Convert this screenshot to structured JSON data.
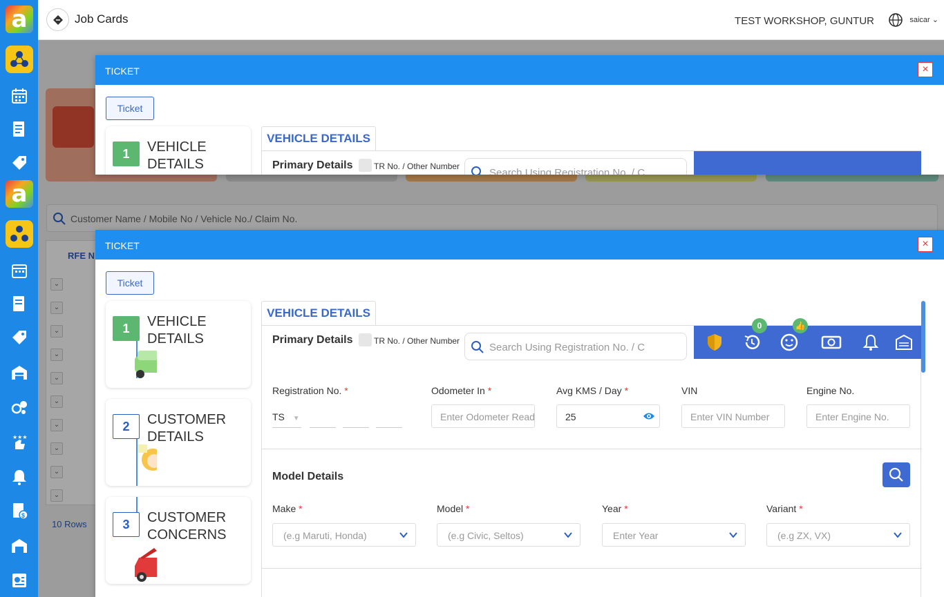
{
  "topbar": {
    "title": "Job Cards",
    "workshop": "TEST WORKSHOP, GUNTUR",
    "username": "saicar"
  },
  "background": {
    "search_placeholder": "Customer Name / Mobile No / Vehicle No./ Claim No.",
    "table_header": "RFE N",
    "rows_label": "10 Rows"
  },
  "modal": {
    "title": "TICKET",
    "close": "×",
    "ticket_button": "Ticket",
    "steps": [
      {
        "num": "1",
        "label_line1": "VEHICLE",
        "label_line2": "DETAILS"
      },
      {
        "num": "2",
        "label_line1": "CUSTOMER",
        "label_line2": "DETAILS"
      },
      {
        "num": "3",
        "label_line1": "CUSTOMER",
        "label_line2": "CONCERNS"
      }
    ],
    "tab": "VEHICLE DETAILS",
    "primary_label": "Primary Details",
    "tr_label": "TR No. / Other Number",
    "reg_search_placeholder": "Search Using Registration No. / Customer",
    "badge_history": "0",
    "fields": {
      "registration": {
        "label": "Registration No.",
        "state": "TS"
      },
      "odometer": {
        "label": "Odometer In",
        "placeholder": "Enter Odometer Reading"
      },
      "avg_kms": {
        "label": "Avg KMS / Day",
        "value": "25"
      },
      "vin": {
        "label": "VIN",
        "placeholder": "Enter VIN Number"
      },
      "engine": {
        "label": "Engine No.",
        "placeholder": "Enter Engine No."
      }
    },
    "model": {
      "title": "Model Details",
      "make": {
        "label": "Make",
        "placeholder": "(e.g Maruti, Honda)"
      },
      "model": {
        "label": "Model",
        "placeholder": "(e.g Civic, Seltos)"
      },
      "year": {
        "label": "Year",
        "placeholder": "Enter Year"
      },
      "variant": {
        "label": "Variant",
        "placeholder": "(e.g ZX, VX)"
      }
    }
  },
  "colors": {
    "sidebar": "#1d88e5",
    "modal_header": "#1e8ff0",
    "accent": "#3e6ad2",
    "step_active": "#5cb870"
  }
}
